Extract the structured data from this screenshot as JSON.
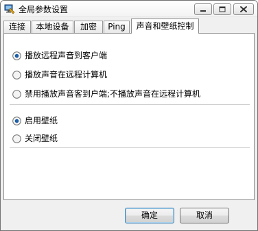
{
  "window": {
    "title": "全局参数设置"
  },
  "tabs": [
    {
      "label": "连接",
      "active": false
    },
    {
      "label": "本地设备",
      "active": false
    },
    {
      "label": "加密",
      "active": false
    },
    {
      "label": "Ping",
      "active": false
    },
    {
      "label": "声音和壁纸控制",
      "active": true
    }
  ],
  "sound_options": [
    {
      "label": "播放远程声音到客户端",
      "checked": true
    },
    {
      "label": "播放声音在远程计算机",
      "checked": false
    },
    {
      "label": "禁用播放声音客到户端;不播放声音在远程计算机",
      "checked": false
    }
  ],
  "wallpaper_options": [
    {
      "label": "启用壁纸",
      "checked": true
    },
    {
      "label": "关闭壁纸",
      "checked": false
    }
  ],
  "buttons": {
    "ok": "确定",
    "cancel": "取消"
  },
  "icons": {
    "app": "app-icon",
    "minimize": "minimize-icon",
    "maximize": "maximize-icon",
    "close": "close-icon"
  }
}
